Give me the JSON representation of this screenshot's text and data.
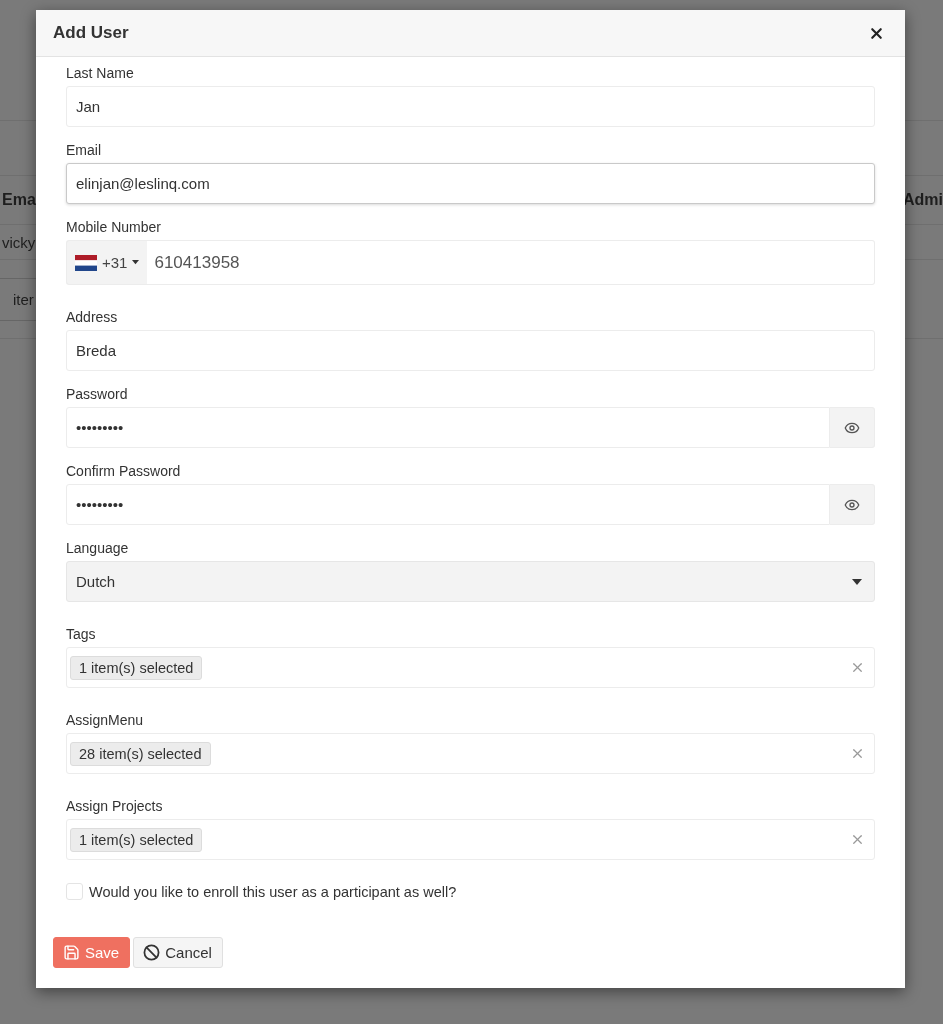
{
  "background": {
    "headers": [
      "Ema",
      "Admi"
    ],
    "row_text": "vicky",
    "chip": "iter"
  },
  "dialog": {
    "title": "Add User",
    "fields": [
      {
        "kind": "text",
        "label": "Last Name",
        "value": "Jan"
      },
      {
        "kind": "text",
        "label": "Email",
        "value": "elinjan@leslinq.com",
        "focused": true
      },
      {
        "kind": "phone",
        "label": "Mobile Number",
        "dial_code": "+31",
        "value": "610413958"
      },
      {
        "kind": "text",
        "label": "Address",
        "value": "Breda"
      },
      {
        "kind": "password",
        "label": "Password",
        "value": "•••••••••"
      },
      {
        "kind": "password",
        "label": "Confirm Password",
        "value": "•••••••••"
      },
      {
        "kind": "select",
        "label": "Language",
        "value": "Dutch"
      },
      {
        "kind": "multiselect",
        "label": "Tags",
        "value": "1 item(s) selected"
      },
      {
        "kind": "multiselect",
        "label": "AssignMenu",
        "value": "28 item(s) selected"
      },
      {
        "kind": "multiselect",
        "label": "Assign Projects",
        "value": "1 item(s) selected"
      }
    ],
    "enroll": {
      "label": "Would you like to enroll this user as a participant as well?",
      "checked": false
    },
    "buttons": [
      {
        "kind": "save",
        "label": "Save"
      },
      {
        "kind": "cancel",
        "label": "Cancel"
      }
    ]
  }
}
